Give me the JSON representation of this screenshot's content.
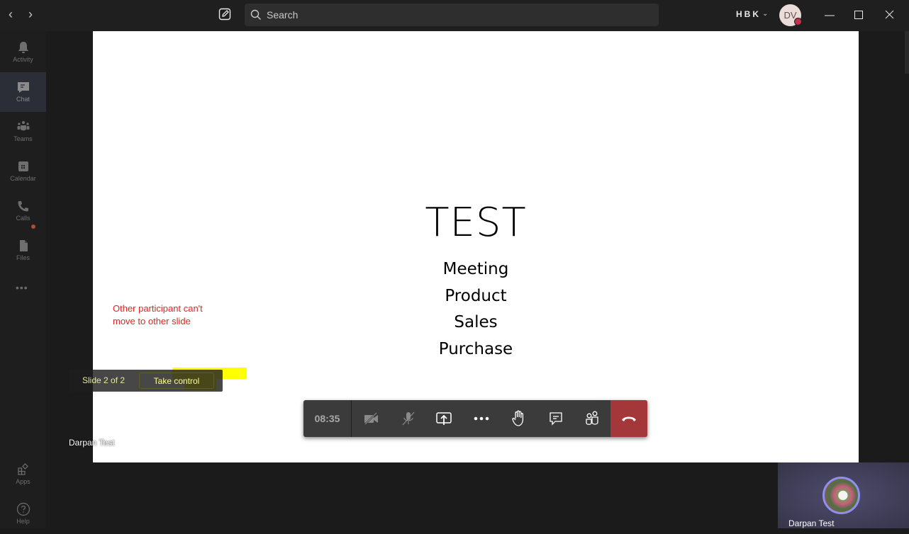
{
  "titlebar": {
    "back_label": "‹",
    "forward_label": "›",
    "search_placeholder": "Search",
    "org_label": "HBK",
    "org_chevron": "⌄",
    "avatar_initials": "DV",
    "presence_color": "#c4314b"
  },
  "rail": {
    "items": [
      {
        "label": "Activity",
        "icon": "bell-icon"
      },
      {
        "label": "Chat",
        "icon": "chat-icon",
        "active": true
      },
      {
        "label": "Teams",
        "icon": "teams-icon"
      },
      {
        "label": "Calendar",
        "icon": "calendar-icon"
      },
      {
        "label": "Calls",
        "icon": "phone-icon",
        "badge": true
      },
      {
        "label": "Files",
        "icon": "file-icon"
      }
    ],
    "more_label": "•••",
    "apps_label": "Apps",
    "help_label": "Help"
  },
  "slide": {
    "title": "TEST",
    "bullets": [
      "Meeting",
      "Product",
      "Sales",
      "Purchase"
    ]
  },
  "annotation": {
    "line1": "Other participant can't",
    "line2": "move to other slide",
    "color": "#e02424"
  },
  "slide_control": {
    "slide_counter": "Slide 2 of 2",
    "take_control_label": "Take control"
  },
  "presenter": {
    "name": "Darpan Test"
  },
  "callbar": {
    "timer": "08:35",
    "buttons": [
      "camera-off",
      "mic-off",
      "share-screen",
      "more-actions",
      "raise-hand",
      "meeting-chat",
      "participants"
    ],
    "hangup_color": "#a4373a"
  },
  "self_view": {
    "name": "Darpan Test"
  }
}
